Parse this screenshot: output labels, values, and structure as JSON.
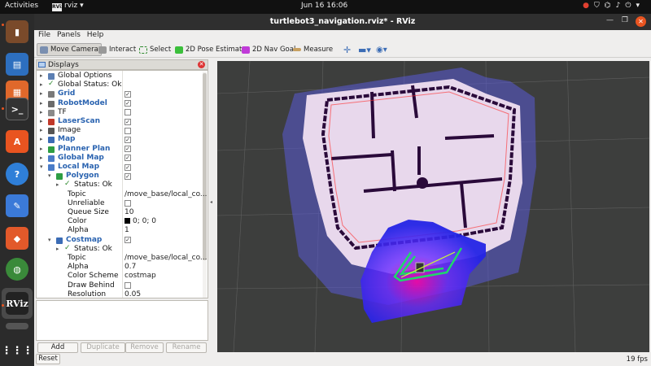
{
  "topbar": {
    "activities": "Activities",
    "app_name": "rviz",
    "app_badge": "RViz",
    "clock": "Jun 16  16:06"
  },
  "window": {
    "title": "turtlebot3_navigation.rviz* - RViz"
  },
  "menubar": {
    "file": "File",
    "panels": "Panels",
    "help": "Help"
  },
  "toolbar": {
    "move_camera": "Move Camera",
    "interact": "Interact",
    "select": "Select",
    "pose_estimate": "2D Pose Estimate",
    "nav_goal": "2D Nav Goal",
    "measure": "Measure"
  },
  "displays": {
    "title": "Displays",
    "rows": [
      {
        "name": "Global Options",
        "style": "plain",
        "indent": 0,
        "arrow": "▸",
        "icon": "gear-icon",
        "icon_color": "#5b7fb3",
        "value": "",
        "checkbox": ""
      },
      {
        "name": "Global Status: Ok",
        "style": "plain",
        "indent": 0,
        "arrow": "▸",
        "icon": "check-icon",
        "icon_color": "#2f8a2f",
        "value": "",
        "checkbox": ""
      },
      {
        "name": "Grid",
        "style": "blue",
        "indent": 0,
        "arrow": "▸",
        "icon": "grid-icon",
        "icon_color": "#7a7a7a",
        "value": "",
        "checkbox": "✓"
      },
      {
        "name": "RobotModel",
        "style": "blue",
        "indent": 0,
        "arrow": "▸",
        "icon": "robot-icon",
        "icon_color": "#6b6b6b",
        "value": "",
        "checkbox": "✓"
      },
      {
        "name": "TF",
        "style": "plain",
        "indent": 0,
        "arrow": "▸",
        "icon": "tf-icon",
        "icon_color": "#8a8a8a",
        "value": "",
        "checkbox": " "
      },
      {
        "name": "LaserScan",
        "style": "blue",
        "indent": 0,
        "arrow": "▸",
        "icon": "laser-icon",
        "icon_color": "#c0392b",
        "value": "",
        "checkbox": "✓"
      },
      {
        "name": "Image",
        "style": "plain",
        "indent": 0,
        "arrow": "▸",
        "icon": "image-icon",
        "icon_color": "#555555",
        "value": "",
        "checkbox": " "
      },
      {
        "name": "Map",
        "style": "blue",
        "indent": 0,
        "arrow": "▸",
        "icon": "map-icon",
        "icon_color": "#3b6cb5",
        "value": "",
        "checkbox": "✓"
      },
      {
        "name": "Planner Plan",
        "style": "blue",
        "indent": 0,
        "arrow": "▸",
        "icon": "path-icon",
        "icon_color": "#2e9e44",
        "value": "",
        "checkbox": "✓"
      },
      {
        "name": "Global Map",
        "style": "blue",
        "indent": 0,
        "arrow": "▸",
        "icon": "folder-icon",
        "icon_color": "#4a7cc8",
        "value": "",
        "checkbox": "✓"
      },
      {
        "name": "Local Map",
        "style": "blue",
        "indent": 0,
        "arrow": "▾",
        "icon": "folder-icon",
        "icon_color": "#4a7cc8",
        "value": "",
        "checkbox": "✓"
      },
      {
        "name": "Polygon",
        "style": "blue",
        "indent": 1,
        "arrow": "▾",
        "icon": "polygon-icon",
        "icon_color": "#2e9e44",
        "value": "",
        "checkbox": "✓"
      },
      {
        "name": "Status: Ok",
        "style": "plain",
        "indent": 2,
        "arrow": "▸",
        "icon": "check-icon",
        "icon_color": "#2f8a2f",
        "value": "",
        "checkbox": ""
      },
      {
        "name": "Topic",
        "style": "plain",
        "indent": 2,
        "arrow": "",
        "icon": "",
        "icon_color": "",
        "value": "/move_base/local_co...",
        "checkbox": ""
      },
      {
        "name": "Unreliable",
        "style": "plain",
        "indent": 2,
        "arrow": "",
        "icon": "",
        "icon_color": "",
        "value": "",
        "checkbox": " "
      },
      {
        "name": "Queue Size",
        "style": "plain",
        "indent": 2,
        "arrow": "",
        "icon": "",
        "icon_color": "",
        "value": "10",
        "checkbox": ""
      },
      {
        "name": "Color",
        "style": "plain",
        "indent": 2,
        "arrow": "",
        "icon": "",
        "icon_color": "",
        "value": "0; 0; 0",
        "checkbox": "",
        "swatch": "#000000"
      },
      {
        "name": "Alpha",
        "style": "plain",
        "indent": 2,
        "arrow": "",
        "icon": "",
        "icon_color": "",
        "value": "1",
        "checkbox": ""
      },
      {
        "name": "Costmap",
        "style": "blue",
        "indent": 1,
        "arrow": "▾",
        "icon": "costmap-icon",
        "icon_color": "#3b6cb5",
        "value": "",
        "checkbox": "✓"
      },
      {
        "name": "Status: Ok",
        "style": "plain",
        "indent": 2,
        "arrow": "▸",
        "icon": "check-icon",
        "icon_color": "#2f8a2f",
        "value": "",
        "checkbox": ""
      },
      {
        "name": "Topic",
        "style": "plain",
        "indent": 2,
        "arrow": "",
        "icon": "",
        "icon_color": "",
        "value": "/move_base/local_co...",
        "checkbox": ""
      },
      {
        "name": "Alpha",
        "style": "plain",
        "indent": 2,
        "arrow": "",
        "icon": "",
        "icon_color": "",
        "value": "0.7",
        "checkbox": ""
      },
      {
        "name": "Color Scheme",
        "style": "plain",
        "indent": 2,
        "arrow": "",
        "icon": "",
        "icon_color": "",
        "value": "costmap",
        "checkbox": ""
      },
      {
        "name": "Draw Behind",
        "style": "plain",
        "indent": 2,
        "arrow": "",
        "icon": "",
        "icon_color": "",
        "value": "",
        "checkbox": " "
      },
      {
        "name": "Resolution",
        "style": "plain",
        "indent": 2,
        "arrow": "",
        "icon": "",
        "icon_color": "",
        "value": "0.05",
        "checkbox": ""
      }
    ],
    "buttons": {
      "add": "Add",
      "duplicate": "Duplicate",
      "remove": "Remove",
      "rename": "Rename"
    },
    "reset": "Reset"
  },
  "status": {
    "fps": "19 fps"
  },
  "colors": {
    "accent": "#e95420",
    "link_blue": "#2a63b0",
    "costmap_pink": "#e8d8ec",
    "costmap_lethal": "#2a0a3a",
    "costmap_inflation": "#ff2a2a",
    "local_costmap_blue": "#2a2aff",
    "footprint_green": "#1fd86a"
  }
}
